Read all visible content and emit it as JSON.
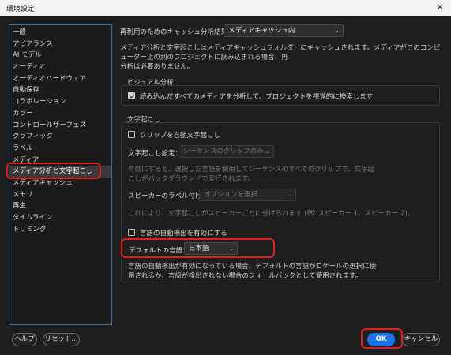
{
  "window": {
    "title": "環境設定",
    "close_glyph": "✕"
  },
  "sidebar": {
    "items": [
      {
        "label": "一般"
      },
      {
        "label": "アピアランス"
      },
      {
        "label": "AI モデル"
      },
      {
        "label": "オーディオ"
      },
      {
        "label": "オーディオハードウェア"
      },
      {
        "label": "自動保存"
      },
      {
        "label": "コラボレーション"
      },
      {
        "label": "カラー"
      },
      {
        "label": "コントロールサーフェス"
      },
      {
        "label": "グラフィック"
      },
      {
        "label": "ラベル"
      },
      {
        "label": "メディア"
      },
      {
        "label": "メディア分析と文字起こし",
        "selected": true
      },
      {
        "label": "メディアキャッシュ"
      },
      {
        "label": "メモリ"
      },
      {
        "label": "再生"
      },
      {
        "label": "タイムライン"
      },
      {
        "label": "トリミング"
      }
    ]
  },
  "cache": {
    "label": "再利用のためのキャッシュ分析結果：",
    "value": "メディアキャッシュ内",
    "desc": [
      "メディア分析と文字起こしはメディアキャッシュフォルダーにキャッシュされます。メディアがこのコンピューター上の別のプロジェクトに読み込まれる場合、再",
      "分析は必要ありません。"
    ]
  },
  "visual": {
    "title": "ビジュアル分析",
    "checkbox_label": "読み込んだすべてのメディアを分析して、プロジェクトを視覚的に検索します",
    "checked": true
  },
  "transcription": {
    "title": "文字起こし",
    "auto_clip_label": "クリップを自動文字起こし",
    "settings_label": "文字起こし設定：",
    "settings_value": "シーケンスのクリップのみ...",
    "settings_desc": [
      "有効にすると、選択した言語を使用してシーケンスのすべてのクリップで、文字起",
      "こしがバックグラウンドで実行されます。"
    ],
    "speaker_label": "スピーカーのラベル付け：",
    "speaker_value": "オプションを選択",
    "speaker_desc": "これにより、文字起こしがスピーカーごとに分けられます (例: スピーカー 1、スピーカー 2)。",
    "auto_detect_label": "言語の自動検出を有効にする",
    "default_lang_label": "デフォルトの言語：",
    "default_lang_value": "日本語",
    "lang_desc": [
      "言語の自動検出が有効になっている場合、デフォルトの言語がロケールの選択に使",
      "用されるか、言語が検出されない場合のフォールバックとして使用されます。"
    ]
  },
  "footer": {
    "help": "ヘルプ",
    "reset": "リセット...",
    "ok": "OK",
    "cancel": "キャンセル"
  },
  "colors": {
    "highlight": "#e0201f",
    "primary": "#1a73e8"
  }
}
